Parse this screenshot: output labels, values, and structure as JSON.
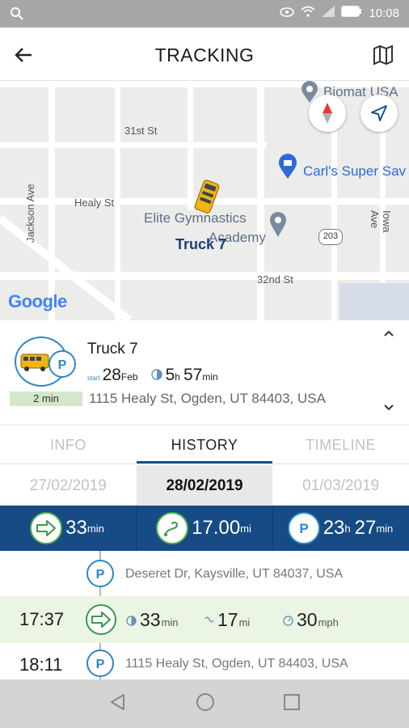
{
  "status_bar": {
    "time": "10:08"
  },
  "header": {
    "title": "TRACKING"
  },
  "map": {
    "streets": [
      "31st St",
      "Healy St",
      "32nd St",
      "Jackson Ave",
      "Iowa Ave"
    ],
    "route_shield": "203",
    "pois": [
      "Biomat USA",
      "Carl's Super Sav",
      "Elite Gymnastics",
      "Academy"
    ],
    "truck_label": "Truck 7",
    "attribution": "Google"
  },
  "truck": {
    "name": "Truck 7",
    "start_tag": "start",
    "start_day": "28",
    "start_month": "Feb",
    "elapsed_h": "5",
    "elapsed_h_unit": "h",
    "elapsed_m": "57",
    "elapsed_m_unit": "min",
    "address": "1115 Healy St, Ogden, UT 84403, USA",
    "stopped_for": "2 min"
  },
  "tabs": [
    {
      "label": "INFO"
    },
    {
      "label": "HISTORY"
    },
    {
      "label": "TIMELINE"
    }
  ],
  "dates": [
    {
      "label": "27/02/2019"
    },
    {
      "label": "28/02/2019"
    },
    {
      "label": "01/03/2019"
    }
  ],
  "summary": {
    "drive_value": "33",
    "drive_unit": "min",
    "distance_value": "17.00",
    "distance_unit": "mi",
    "park_h": "23",
    "park_h_unit": "h",
    "park_m": "27",
    "park_m_unit": "min"
  },
  "timeline": {
    "stop1_address": "Deseret Dr, Kaysville, UT 84037, USA",
    "trip_time": "17:37",
    "trip_duration": "33",
    "trip_duration_unit": "min",
    "trip_distance": "17",
    "trip_distance_unit": "mi",
    "trip_speed": "30",
    "trip_speed_unit": "mph",
    "stop2_time": "18:11",
    "stop2_address": "1115 Healy St, Ogden, UT 84403, USA"
  },
  "colors": {
    "brand_blue": "#174b85",
    "accent_blue": "#2f86c6",
    "trip_green": "#3a9a4a",
    "trip_row_bg": "#eaf5e4"
  }
}
